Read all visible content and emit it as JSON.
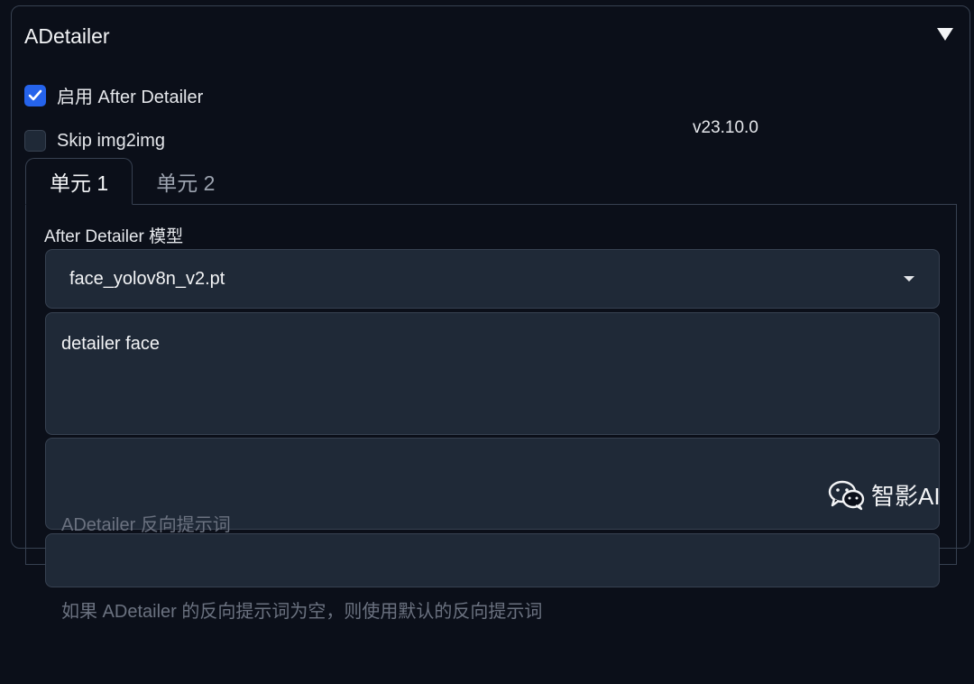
{
  "panel": {
    "title": "ADetailer",
    "toggle_icon": "triangle-down-icon"
  },
  "options": {
    "enable_label": "启用 After Detailer",
    "enable_checked": true,
    "skip_label": "Skip img2img",
    "skip_checked": false,
    "version": "v23.10.0"
  },
  "tabs": [
    {
      "label": "单元 1",
      "active": true
    },
    {
      "label": "单元 2",
      "active": false
    }
  ],
  "unit": {
    "model_label": "After Detailer 模型",
    "model_value": "face_yolov8n_v2.pt",
    "prompt_value": "detailer face",
    "negative_placeholder_line1": "ADetailer 反向提示词",
    "negative_placeholder_line2": "如果 ADetailer 的反向提示词为空，则使用默认的反向提示词"
  },
  "watermark": {
    "text": "智影AI",
    "icon": "wechat-icon"
  },
  "colors": {
    "background": "#0b0f19",
    "field": "#1f2937",
    "border": "#374151",
    "accent": "#2563eb"
  }
}
